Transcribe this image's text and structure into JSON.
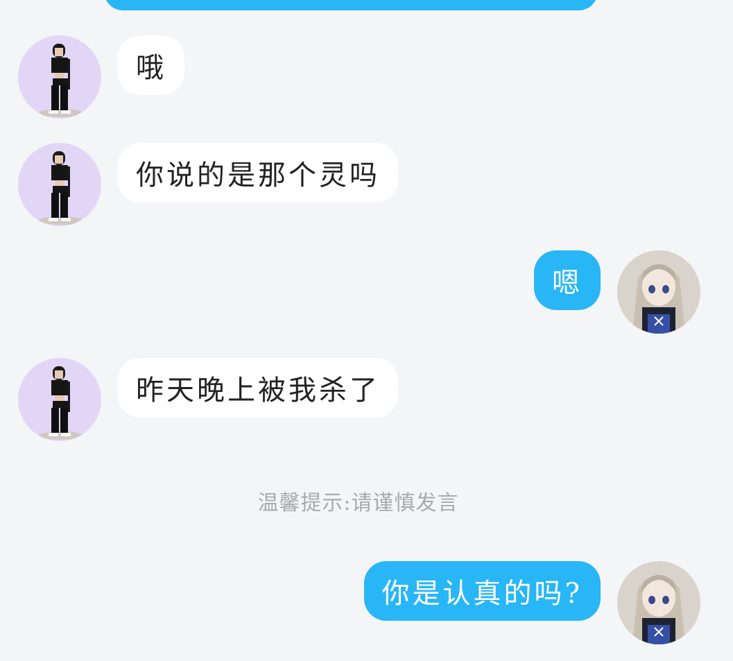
{
  "colors": {
    "background": "#f4f5f7",
    "self_bubble": "#29b6f6",
    "other_bubble": "#ffffff",
    "notice_text": "#a9aaad"
  },
  "messages": [
    {
      "from": "other",
      "text": "哦"
    },
    {
      "from": "other",
      "text": "你说的是那个灵吗"
    },
    {
      "from": "self",
      "text": "嗯"
    },
    {
      "from": "other",
      "text": "昨天晚上被我杀了"
    },
    {
      "from": "self",
      "text": "你是认真的吗?"
    }
  ],
  "notice": "温馨提示:请谨慎发言"
}
